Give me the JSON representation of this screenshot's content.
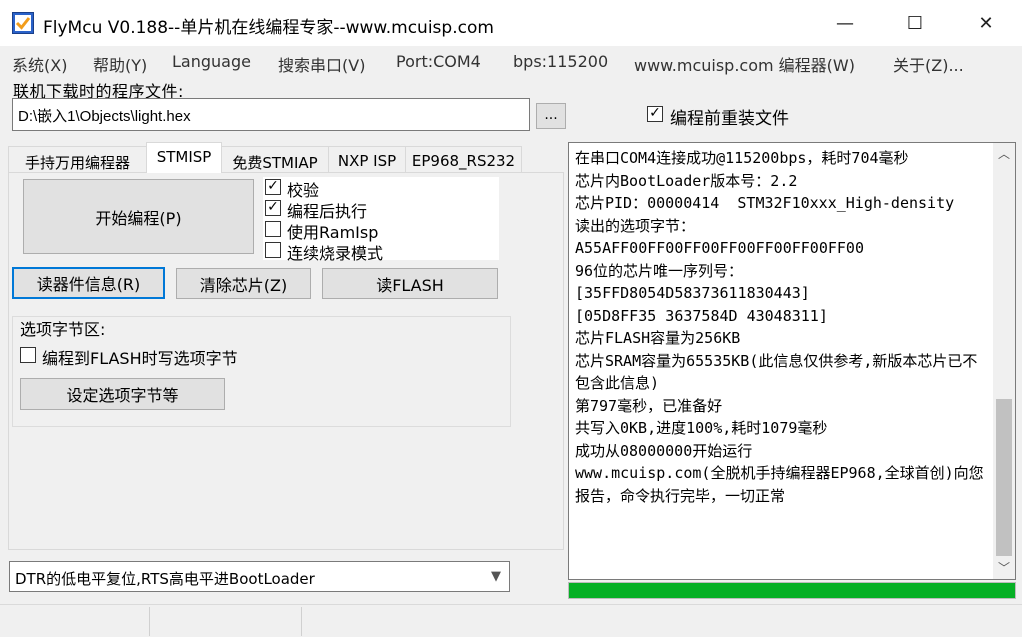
{
  "window": {
    "title": "FlyMcu V0.188--单片机在线编程专家--www.mcuisp.com",
    "minimize": "—",
    "maximize": "☐",
    "close": "✕",
    "icon": "check-box-app-icon"
  },
  "menu": [
    "系统(X)",
    "帮助(Y)",
    "Language",
    "搜索串口(V)",
    "Port:COM4",
    "bps:115200",
    "www.mcuisp.com 编程器(W)",
    "关于(Z)..."
  ],
  "file": {
    "label": "联机下载时的程序文件:",
    "path": "D:\\嵌入1\\Objects\\light.hex",
    "browse": "...",
    "reload_label": "编程前重装文件",
    "reload_checked": true
  },
  "tabs": [
    "手持万用编程器",
    "STMISP",
    "免费STMIAP",
    "NXP ISP",
    "EP968_RS232"
  ],
  "active_tab": "STMISP",
  "stmisp": {
    "start_button": "开始编程(P)",
    "options": [
      {
        "label": "校验",
        "checked": true
      },
      {
        "label": "编程后执行",
        "checked": true
      },
      {
        "label": "使用RamIsp",
        "checked": false
      },
      {
        "label": "连续烧录模式",
        "checked": false
      }
    ],
    "read_info_button": "读器件信息(R)",
    "erase_button": "清除芯片(Z)",
    "read_flash_button": "读FLASH",
    "option_group": {
      "title": "选项字节区:",
      "write_option_label": "编程到FLASH时写选项字节",
      "write_option_checked": false,
      "set_option_button": "设定选项字节等"
    }
  },
  "reset_mode": "DTR的低电平复位,RTS高电平进BootLoader",
  "log": [
    "在串口COM4连接成功@115200bps，耗时704毫秒",
    "芯片内BootLoader版本号：2.2",
    "芯片PID：00000414  STM32F10xxx_High-density",
    "读出的选项字节：",
    "A55AFF00FF00FF00FF00FF00FF00FF00",
    "96位的芯片唯一序列号：",
    "[35FFD8054D58373611830443]",
    "[05D8FF35 3637584D 43048311]",
    "芯片FLASH容量为256KB",
    "芯片SRAM容量为65535KB(此信息仅供参考,新版本芯片已不包含此信息)",
    "第797毫秒，已准备好",
    "共写入0KB,进度100%,耗时1079毫秒",
    "成功从08000000开始运行",
    "www.mcuisp.com(全脱机手持编程器EP968,全球首创)向您报告，命令执行完毕，一切正常"
  ],
  "progress_percent": 100,
  "colors": {
    "progress": "#06b025"
  }
}
